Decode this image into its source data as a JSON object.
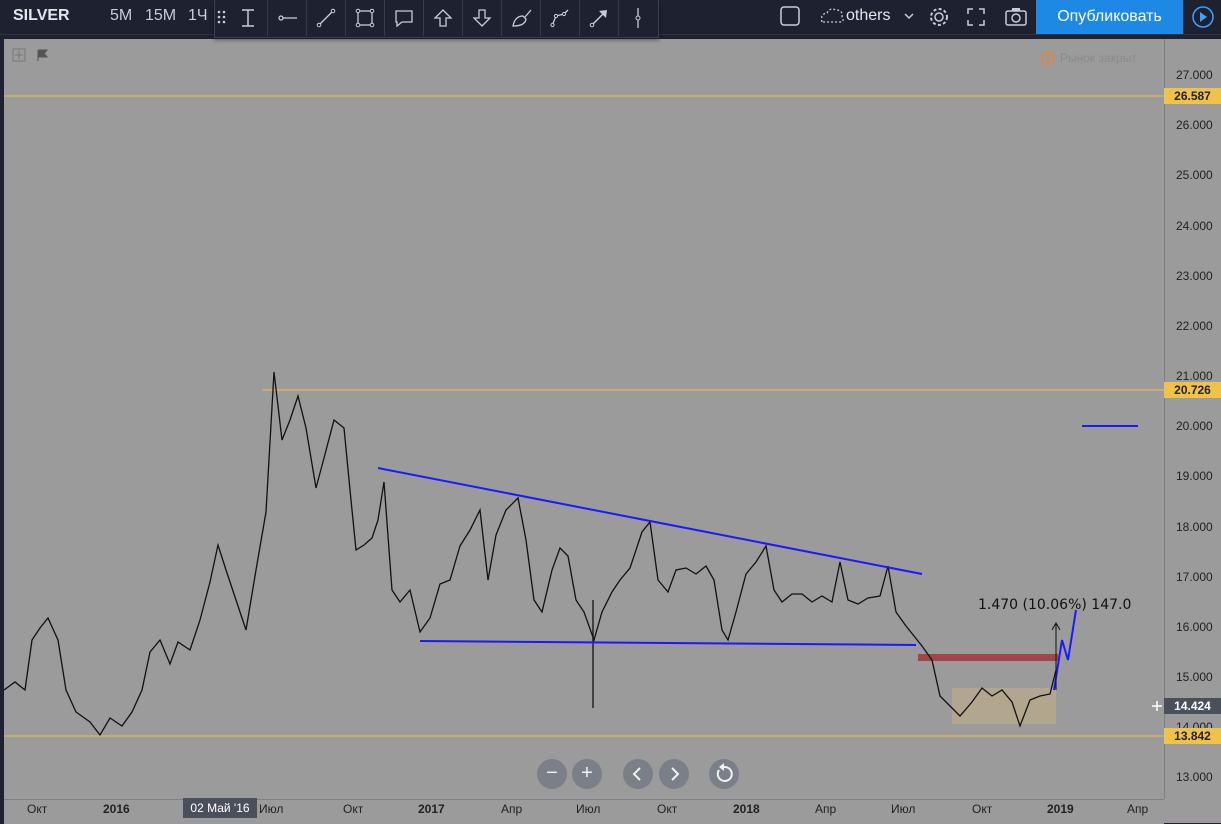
{
  "header": {
    "symbol": "SILVER",
    "timeframes": [
      "5M",
      "15M",
      "1Ч"
    ],
    "drawing_tools": [
      "cursor-tool-icon",
      "horizontal-ray-icon",
      "trend-line-icon",
      "rectangle-icon",
      "callout-icon",
      "arrow-up-icon",
      "arrow-down-icon",
      "brush-icon",
      "path-icon",
      "arrow-tool-icon",
      "vertical-line-icon"
    ],
    "layout_name": "others",
    "publish_label": "Опубликовать"
  },
  "chart": {
    "price_labels": [
      "27.000",
      "26.000",
      "25.000",
      "24.000",
      "23.000",
      "22.000",
      "21.000",
      "20.000",
      "19.000",
      "18.000",
      "17.000",
      "16.000",
      "15.000",
      "14.000",
      "13.000"
    ],
    "price_tags": {
      "level_high": "26.587",
      "level_mid": "20.726",
      "current": "14.424",
      "level_low": "13.842"
    },
    "time_labels": [
      "Окт",
      "2016",
      "Июл",
      "Окт",
      "2017",
      "Апр",
      "Июл",
      "Окт",
      "2018",
      "Апр",
      "Июл",
      "Окт",
      "2019",
      "Апр"
    ],
    "cursor_date": "02 Май '16",
    "measure_text": "1.470 (10.06%) 147.0",
    "warning_text": "Рынок закрыт",
    "colors": {
      "background": "#9b9b9b",
      "level_line": "#f0c24a",
      "trend_line": "#1a1aff",
      "candles": "#111111",
      "zone_red": "#a0464a",
      "zone_tan": "#b9a98a",
      "accent": "#1e88e5"
    }
  }
}
